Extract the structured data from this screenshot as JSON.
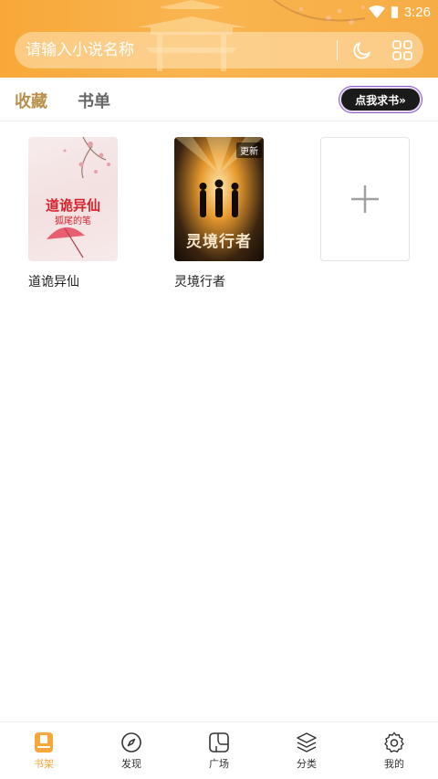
{
  "status_bar": {
    "time": "3:26"
  },
  "search": {
    "placeholder": "请输入小说名称"
  },
  "tabs": [
    {
      "label": "收藏",
      "active": true
    },
    {
      "label": "书单",
      "active": false
    }
  ],
  "request_button": {
    "label": "点我求书»"
  },
  "books": [
    {
      "title": "道诡异仙",
      "cover_title": "道诡异仙",
      "cover_author": "狐尾的笔",
      "badge": ""
    },
    {
      "title": "灵境行者",
      "cover_title": "灵境行者",
      "cover_author": "",
      "badge": "更新"
    }
  ],
  "add_tile": {
    "icon": "plus-icon"
  },
  "bottom_nav": [
    {
      "label": "书架",
      "icon": "bookshelf-icon",
      "active": true
    },
    {
      "label": "发现",
      "icon": "compass-icon",
      "active": false
    },
    {
      "label": "广场",
      "icon": "square-icon",
      "active": false
    },
    {
      "label": "分类",
      "icon": "layers-icon",
      "active": false
    },
    {
      "label": "我的",
      "icon": "gear-icon",
      "active": false
    }
  ],
  "colors": {
    "accent": "#f6a739",
    "tab_active": "#b8904a",
    "header_bg": "#f8a838"
  }
}
